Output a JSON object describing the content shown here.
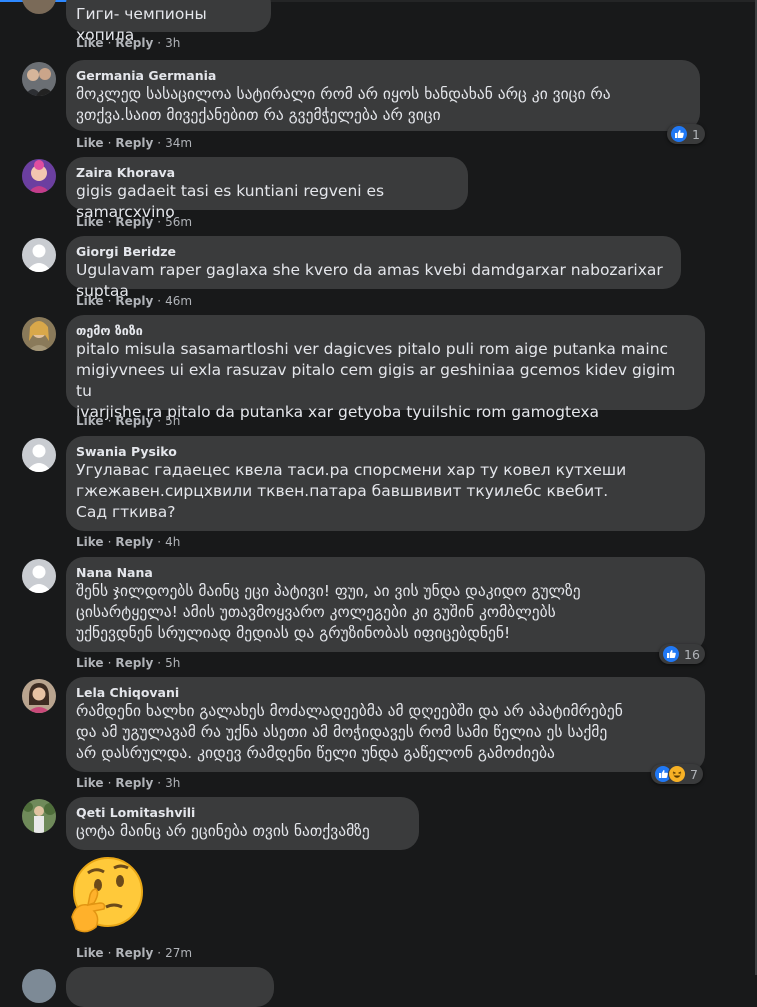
{
  "actions": {
    "like": "Like",
    "reply": "Reply",
    "sep": "·"
  },
  "comments": [
    {
      "name": "",
      "text": "Гиги- чемпионы хопила",
      "time": "3h"
    },
    {
      "name": "Germania Germania",
      "text": "მოკლედ სასაცილოა სატირალი რომ არ იყოს ხანდახან არც კი ვიცი რა\nვთქვა.საით მივექანებით რა გვემჭელება არ ვიცი",
      "time": "34m",
      "reactions": "1"
    },
    {
      "name": "Zaira Khorava",
      "text": "gigis gadaeit tasi es kuntiani regveni es samarcxvino",
      "time": "56m"
    },
    {
      "name": "Giorgi Beridze",
      "text": "Ugulavam raper gaglaxa she kvero da amas kvebi damdgarxar nabozarixar suptaa",
      "time": "46m"
    },
    {
      "name": "თემო ზიზი",
      "text": "pitalo misula sasamartloshi ver dagicves pitalo puli rom aige putanka mainc\nmigiyvnees ui exla rasuzav pitalo cem gigis ar geshiniaa gcemos kidev gigim tu\nivarjishe ra pitalo da putanka xar getyoba tyuilshic rom gamogtexa",
      "time": "5h"
    },
    {
      "name": "Swania Pysiko",
      "text": "Угулавас гадаецес квела таси.ра спорсмени хар ту ковел кутхеши\nгжежавен.сирцхвили тквен.патара бавшвивит ткуилебс квебит.\nСад гткива?",
      "time": "4h"
    },
    {
      "name": "Nana Nana",
      "text": "შენს ჯილდოებს მაინც ეცი პატივი! ფუი, აი ვის უნდა დაკიდო გულზე\nცისარტყელა! ამის უთავმოყვარო კოლეგები კი გუშინ კომბლებს\nუქნევდნენ სრულიად მედიას და გრუზინობას იფიცებდნენ!",
      "time": "5h",
      "reactions": "16"
    },
    {
      "name": "Lela Chiqovani",
      "text": "რამდენი ხალხი გალახეს მოძალადეებმა ამ დღეებში და არ აპატიმრებენ\nდა ამ უგულავამ რა უქნა ასეთი ამ მოჭიდავეს რომ სამი წელია ეს საქმე\nარ დასრულდა. კიდევ რამდენი წელი უნდა გაწელონ გამოძიება",
      "time": "3h",
      "reactions": "7"
    },
    {
      "name": "Qeti Lomitashvili",
      "text": "ცოტა მაინც არ ეცინება თვის ნათქვამზე",
      "time": "27m"
    }
  ],
  "colors": {
    "background": "#18191a",
    "bubble": "#3a3b3c",
    "text": "#e4e6eb",
    "meta": "#b0b3b8",
    "like": "#2078f4"
  },
  "icons": [
    "like-icon",
    "haha-icon",
    "thinking-face-emoji"
  ]
}
